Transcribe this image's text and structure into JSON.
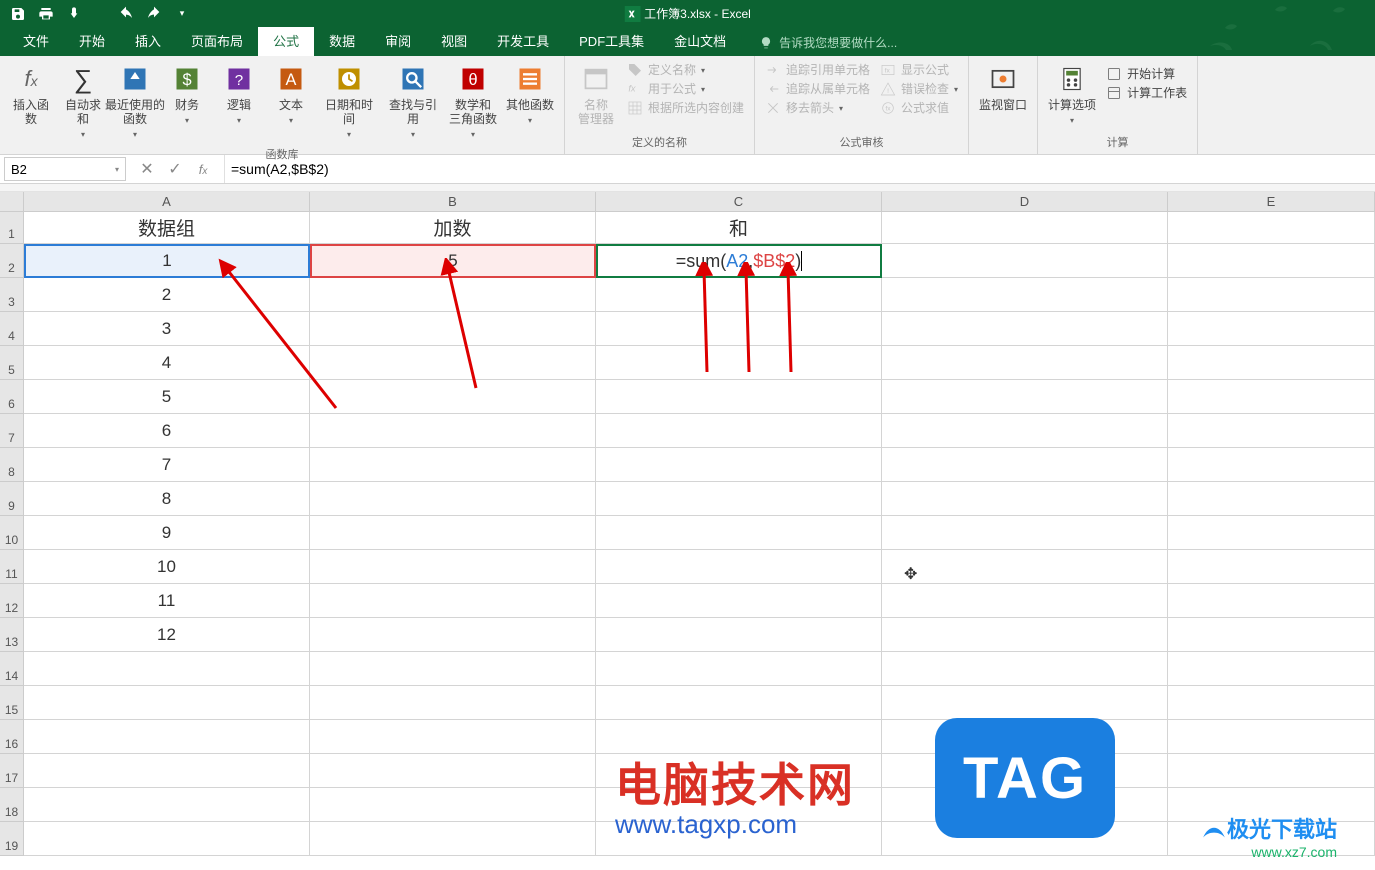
{
  "titlebar": {
    "doc_title": "工作簿3.xlsx - Excel"
  },
  "menu": {
    "file": "文件",
    "home": "开始",
    "insert": "插入",
    "page_layout": "页面布局",
    "formulas": "公式",
    "data": "数据",
    "review": "审阅",
    "view": "视图",
    "developer": "开发工具",
    "pdf": "PDF工具集",
    "kingsoft": "金山文档",
    "tell_me": "告诉我您想要做什么..."
  },
  "ribbon": {
    "insert_fn": "插入函数",
    "autosum": "自动求和",
    "recent": "最近使用的\n函数",
    "financial": "财务",
    "logical": "逻辑",
    "text": "文本",
    "datetime": "日期和时间",
    "lookup": "查找与引用",
    "math": "数学和\n三角函数",
    "more": "其他函数",
    "group_lib": "函数库",
    "name_mgr": "名称\n管理器",
    "define_name": "定义名称",
    "use_in_formula": "用于公式",
    "from_selection": "根据所选内容创建",
    "group_names": "定义的名称",
    "trace_prec": "追踪引用单元格",
    "trace_dep": "追踪从属单元格",
    "remove_arrows": "移去箭头",
    "show_formulas": "显示公式",
    "error_check": "错误检查",
    "eval_formula": "公式求值",
    "group_audit": "公式审核",
    "watch": "监视窗口",
    "calc_opts": "计算选项",
    "calc_now": "开始计算",
    "calc_sheet": "计算工作表",
    "group_calc": "计算"
  },
  "fbar": {
    "name_box": "B2",
    "formula": "=sum(A2,$B$2)"
  },
  "grid": {
    "cols": [
      "A",
      "B",
      "C",
      "D",
      "E"
    ],
    "header_row": {
      "A": "数据组",
      "B": "加数",
      "C": "和"
    },
    "A": [
      "1",
      "2",
      "3",
      "4",
      "5",
      "6",
      "7",
      "8",
      "9",
      "10",
      "11",
      "12"
    ],
    "B2": "5",
    "C2_formula_display": {
      "pre": "=sum(",
      "ref1": "A2",
      "sep": ",",
      "ref2": "$B$2",
      "post": ")"
    }
  },
  "watermark": {
    "title": "电脑技术网",
    "url": "www.tagxp.com",
    "tag": "TAG",
    "site2": "极光下载站",
    "url2": "www.xz7.com"
  }
}
